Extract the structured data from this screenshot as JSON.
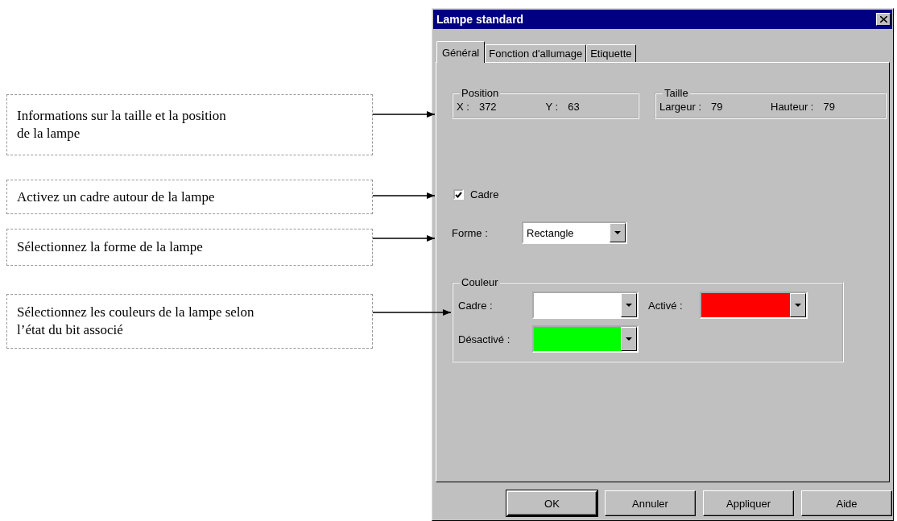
{
  "callouts": [
    {
      "text": "Informations sur la taille et la position\nde la lampe"
    },
    {
      "text": "Activez un cadre autour de la lampe"
    },
    {
      "text": "Sélectionnez la forme de la lampe"
    },
    {
      "text": "Sélectionnez les couleurs de la lampe selon\nl’état du bit associé"
    }
  ],
  "dialog": {
    "title": "Lampe standard",
    "tabs": [
      {
        "label": "Général",
        "selected": true
      },
      {
        "label": "Fonction d'allumage",
        "selected": false
      },
      {
        "label": "Etiquette",
        "selected": false
      }
    ],
    "position": {
      "title": "Position",
      "fields": [
        {
          "label": "X :",
          "value": "372"
        },
        {
          "label": "Y :",
          "value": "63"
        }
      ]
    },
    "size": {
      "title": "Taille",
      "fields": [
        {
          "label": "Largeur :",
          "value": "79"
        },
        {
          "label": "Hauteur :",
          "value": "79"
        }
      ]
    },
    "frame_checkbox": {
      "label": "Cadre",
      "checked": true
    },
    "shape": {
      "label": "Forme :",
      "value": "Rectangle"
    },
    "color_group": {
      "title": "Couleur",
      "pickers": [
        {
          "label": "Cadre :",
          "color": "#ffffff"
        },
        {
          "label": "Activé :",
          "color": "#ff0000"
        },
        {
          "label": "Désactivé :",
          "color": "#00ff00"
        }
      ]
    },
    "buttons": [
      {
        "label": "OK",
        "default": true
      },
      {
        "label": "Annuler",
        "default": false
      },
      {
        "label": "Appliquer",
        "default": false
      },
      {
        "label": "Aide",
        "default": false
      }
    ]
  }
}
